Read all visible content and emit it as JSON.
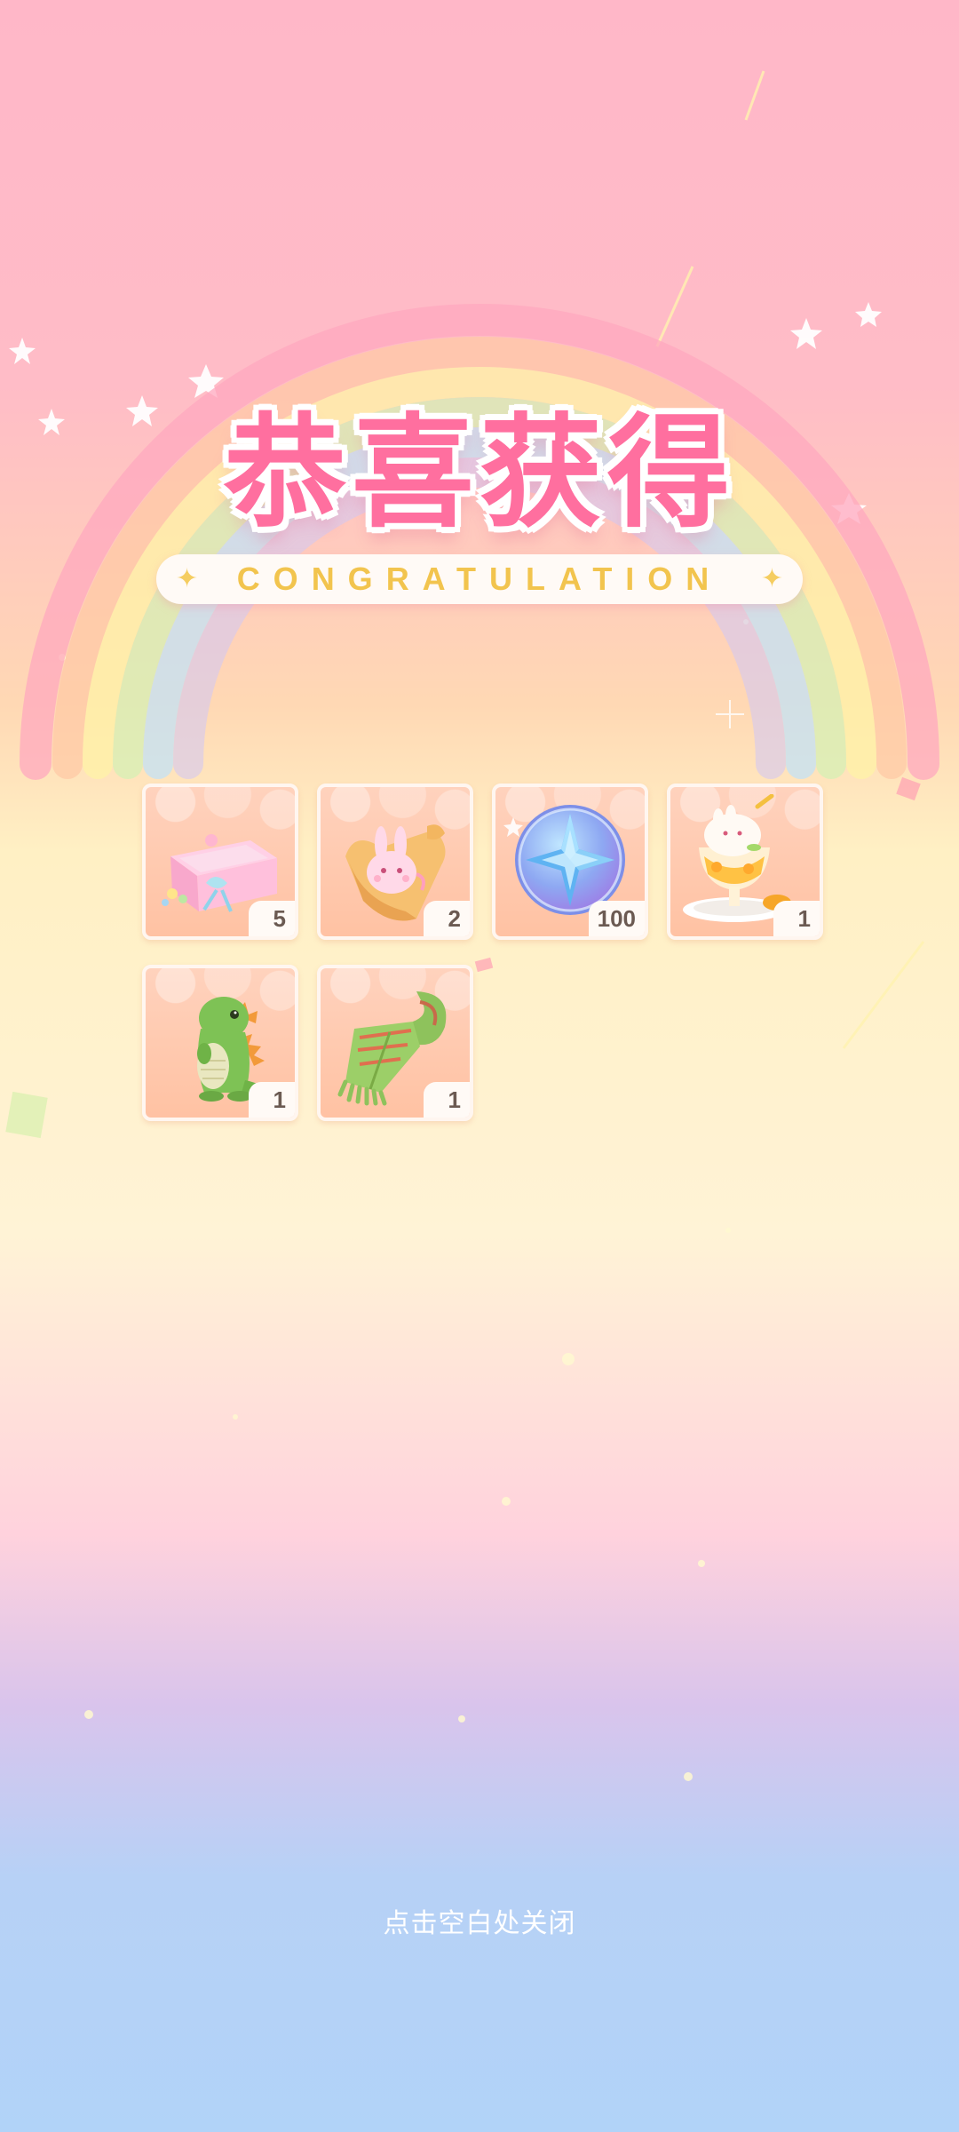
{
  "title": {
    "chinese": "恭喜获得",
    "english": "CONGRATULATION"
  },
  "rewards": [
    {
      "icon": "gift-box-icon",
      "quantity": "5"
    },
    {
      "icon": "bunny-pouch-icon",
      "quantity": "2"
    },
    {
      "icon": "star-coin-icon",
      "quantity": "100"
    },
    {
      "icon": "ice-cream-sundae-icon",
      "quantity": "1"
    },
    {
      "icon": "green-dinosaur-plush-icon",
      "quantity": "1"
    },
    {
      "icon": "green-scarf-icon",
      "quantity": "1"
    }
  ],
  "close_hint": "点击空白处关闭",
  "colors": {
    "title_pink": "#ff6f9f",
    "banner_text_gold": "#f2c44e",
    "item_bg": "#ffc7aa",
    "qty_text": "#6b5a52"
  }
}
